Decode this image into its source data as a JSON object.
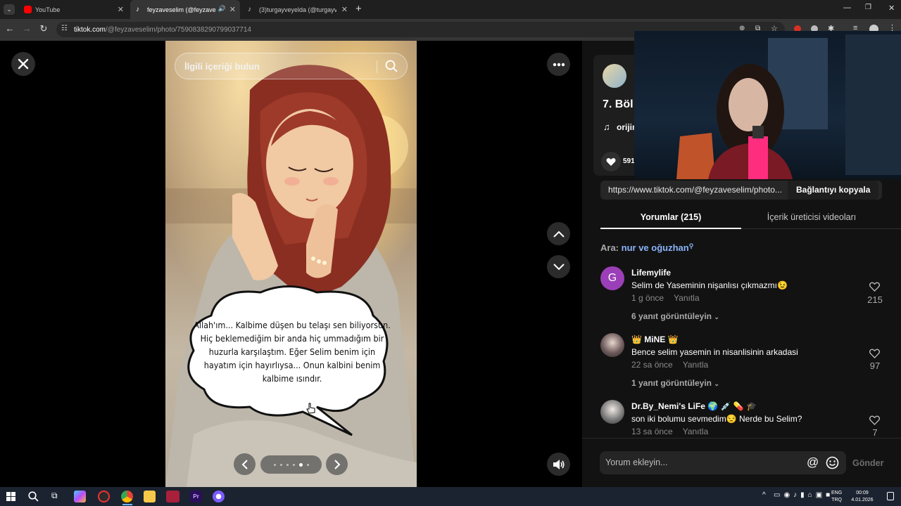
{
  "browser": {
    "tabs": [
      {
        "label": "YouTube",
        "active": false
      },
      {
        "label": "feyzaveselim (@feyzavesel",
        "active": true
      },
      {
        "label": "(3)turgayveyelda (@turgayve",
        "active": false
      }
    ],
    "url_host": "tiktok.com",
    "url_path": "/@feyzaveselim/photo/7590838290799037714"
  },
  "viewer": {
    "search_placeholder": "İlgili içeriği bulun",
    "bubble_text": "Allah'ım... Kalbime düşen bu telaşı sen biliyorsun. Hiç beklemediğim bir anda hiç ummadığım bir huzurla karşılaştım. Eğer Selim benim için hayatım için hayırlıysa... Onun kalbini benim kalbime ısındır.",
    "carousel_dots": 6,
    "carousel_active": 4
  },
  "post": {
    "title_partial": "7. Böl",
    "music_partial": "orijin",
    "likes_partial": "591",
    "link": "https://www.tiktok.com/@feyzaveselim/photo...",
    "copy_label": "Bağlantıyı kopyala"
  },
  "tabs": {
    "comments": "Yorumlar (215)",
    "creator": "İçerik üreticisi videoları"
  },
  "search_suggestion": {
    "prefix": "Ara:",
    "query": "nur ve oğuzhan"
  },
  "comments": [
    {
      "avatar_letter": "G",
      "name": "Lifemylife",
      "text": "Selim de Yaseminin nişanlısı çıkmazmı😉",
      "time": "1 g önce",
      "reply": "Yanıtla",
      "likes": "215",
      "replies": "6 yanıt görüntüleyin"
    },
    {
      "avatar_letter": "",
      "name": "👑 MiNE 👑",
      "text": "Bence selim yasemin in nisanlisinin arkadasi",
      "time": "22 sa önce",
      "reply": "Yanıtla",
      "likes": "97",
      "replies": "1 yanıt görüntüleyin"
    },
    {
      "avatar_letter": "",
      "name": "Dr.By_Nemi's LiFe 🌍 💉 💊 🎓",
      "text": "son iki bolumu sevmedim😒 Nerde bu Selim?",
      "time": "13 sa önce",
      "reply": "Yanıtla",
      "likes": "7",
      "replies": ""
    }
  ],
  "comment_input": {
    "placeholder": "Yorum ekleyin...",
    "send": "Gönder"
  },
  "taskbar": {
    "lang1": "ENG",
    "lang2": "TRQ",
    "time": "00:09",
    "date": "4.01.2026"
  },
  "colors": {
    "tiktok_accent": "#fe2c55",
    "link_blue": "#8ab4f8",
    "avatar_purple": "#9b3fb8"
  }
}
